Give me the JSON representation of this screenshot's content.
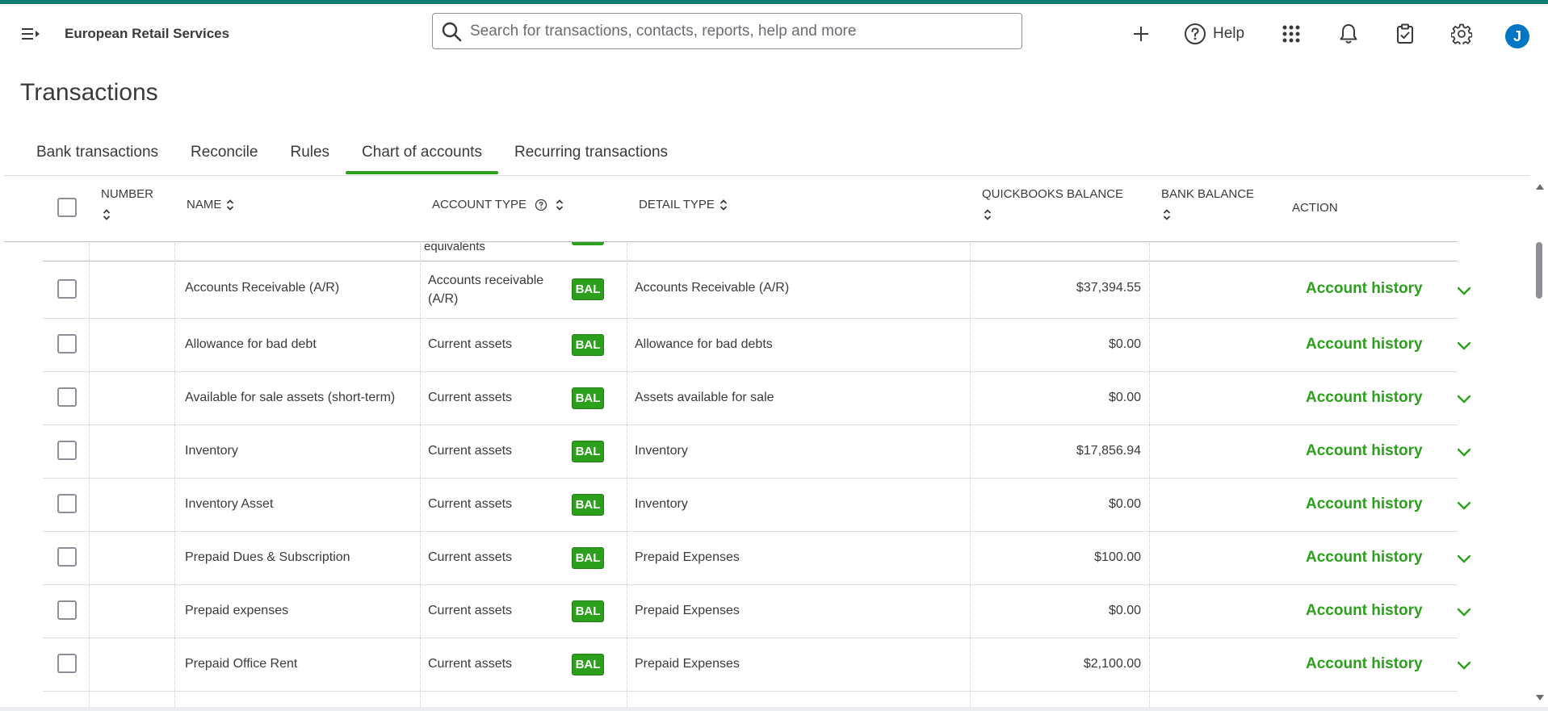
{
  "app": {
    "company_name": "European Retail Services",
    "search_placeholder": "Search for transactions, contacts, reports, help and more",
    "help_label": "Help",
    "avatar_initial": "J",
    "accent_color": "#2ca01c"
  },
  "icons": [
    "menu-icon",
    "search-icon",
    "plus-icon",
    "help-icon",
    "apps-grid-icon",
    "bell-icon",
    "clipboard-icon",
    "gear-icon"
  ],
  "page": {
    "title": "Transactions"
  },
  "tabs": [
    {
      "label": "Bank transactions"
    },
    {
      "label": "Reconcile"
    },
    {
      "label": "Rules"
    },
    {
      "label": "Chart of accounts",
      "active": true
    },
    {
      "label": "Recurring transactions"
    }
  ],
  "table": {
    "columns": {
      "number": "NUMBER",
      "name": "NAME",
      "account_type": "ACCOUNT TYPE",
      "detail_type": "DETAIL TYPE",
      "qb_balance": "QUICKBOOKS BALANCE",
      "bank_balance": "BANK BALANCE",
      "action": "ACTION"
    },
    "partial_row_text": "equivalents",
    "rows": [
      {
        "name": "Accounts Receivable (A/R)",
        "account_type": "Accounts receivable (A/R)",
        "badge": "BAL",
        "detail_type": "Accounts Receivable (A/R)",
        "qb_balance": "$37,394.55",
        "action": "Account history"
      },
      {
        "name": "Allowance for bad debt",
        "account_type": "Current assets",
        "badge": "BAL",
        "detail_type": "Allowance for bad debts",
        "qb_balance": "$0.00",
        "action": "Account history"
      },
      {
        "name": "Available for sale assets (short-term)",
        "account_type": "Current assets",
        "badge": "BAL",
        "detail_type": "Assets available for sale",
        "qb_balance": "$0.00",
        "action": "Account history"
      },
      {
        "name": "Inventory",
        "account_type": "Current assets",
        "badge": "BAL",
        "detail_type": "Inventory",
        "qb_balance": "$17,856.94",
        "action": "Account history"
      },
      {
        "name": "Inventory Asset",
        "account_type": "Current assets",
        "badge": "BAL",
        "detail_type": "Inventory",
        "qb_balance": "$0.00",
        "action": "Account history"
      },
      {
        "name": "Prepaid Dues & Subscription",
        "account_type": "Current assets",
        "badge": "BAL",
        "detail_type": "Prepaid Expenses",
        "qb_balance": "$100.00",
        "action": "Account history"
      },
      {
        "name": "Prepaid expenses",
        "account_type": "Current assets",
        "badge": "BAL",
        "detail_type": "Prepaid Expenses",
        "qb_balance": "$0.00",
        "action": "Account history"
      },
      {
        "name": "Prepaid Office Rent",
        "account_type": "Current assets",
        "badge": "BAL",
        "detail_type": "Prepaid Expenses",
        "qb_balance": "$2,100.00",
        "action": "Account history"
      }
    ]
  }
}
